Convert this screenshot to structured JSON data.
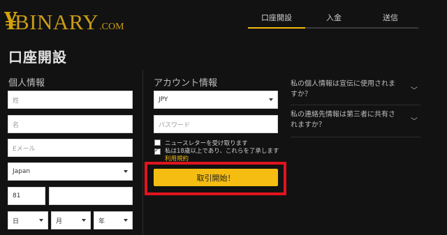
{
  "logo": {
    "yen": "¥",
    "main": "BINARY",
    "com": ".COM"
  },
  "steps": [
    "口座開設",
    "入金",
    "送信"
  ],
  "page_title": "口座開設",
  "personal": {
    "title": "個人情報",
    "last_name_placeholder": "姓",
    "first_name_placeholder": "名",
    "email_placeholder": "Eメール",
    "country_value": "Japan",
    "phone_code": "81",
    "day_label": "日",
    "month_label": "月",
    "year_label": "年"
  },
  "account": {
    "title": "アカウント情報",
    "currency_value": "JPY",
    "password_placeholder": "パスワード",
    "newsletter_label": "ニュースレターを受け取ります",
    "agree_label": "私は18歳以上であり、これらを了承します",
    "terms_link": "利用規約",
    "cta_label": "取引開始！"
  },
  "faq": [
    {
      "question": "私の個人情報は宣伝に使用されますか？"
    },
    {
      "question": "私の連絡先情報は第三者に共有されますか？"
    }
  ],
  "colors": {
    "background": "#121212",
    "accent": "#f2b90f",
    "highlight": "#e0141d"
  }
}
